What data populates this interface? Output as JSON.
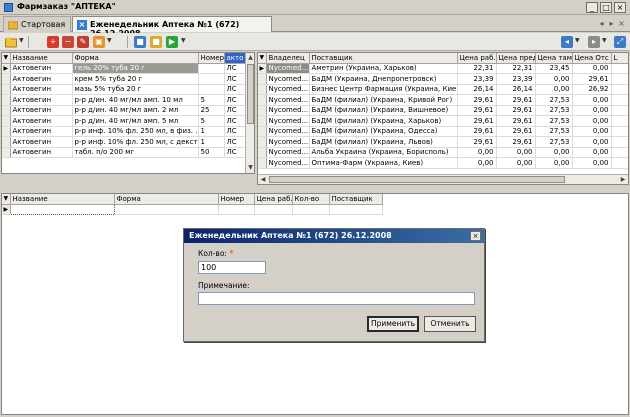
{
  "window": {
    "title": "Фармзаказ \"АПТЕКА\"",
    "min_glyph": "_",
    "max_glyph": "□",
    "close_glyph": "×"
  },
  "tabs": [
    {
      "label": "Стартовая"
    },
    {
      "label": "Еженедельник Аптека №1 (672) 26.12.2008",
      "close_glyph": "×"
    }
  ],
  "colors": {
    "accent": "#2f65c9",
    "dialog_title": "#0a246a",
    "selection": "#9a9994"
  },
  "toolbar_icons": [
    "folder-icon",
    "add-icon",
    "remove-icon",
    "edit-icon",
    "export-icon",
    "cubes-icon",
    "package-icon",
    "play-icon",
    "back-icon",
    "forward-icon",
    "expand-icon"
  ],
  "products": {
    "columns": [
      "Название",
      "Форма",
      "Номер",
      "акто"
    ],
    "rows": [
      {
        "name": "Актовегин",
        "form": "гель 20% туба 20 г",
        "number": "",
        "type": "ЛС"
      },
      {
        "name": "Актовегин",
        "form": "крем 5% туба 20 г",
        "number": "",
        "type": "ЛС"
      },
      {
        "name": "Актовегин",
        "form": "мазь 5% туба 20 г",
        "number": "",
        "type": "ЛС"
      },
      {
        "name": "Актовегин",
        "form": "р-р д/ин. 40 мг/мл амп. 10 мл",
        "number": "5",
        "type": "ЛС"
      },
      {
        "name": "Актовегин",
        "form": "р-р д/ин. 40 мг/мл амп. 2 мл",
        "number": "25",
        "type": "ЛС"
      },
      {
        "name": "Актовегин",
        "form": "р-р д/ин. 40 мг/мл амп. 5 мл",
        "number": "5",
        "type": "ЛС"
      },
      {
        "name": "Актовегин",
        "form": "р-р инф. 10% фл. 250 мл, в физ. ...",
        "number": "1",
        "type": "ЛС"
      },
      {
        "name": "Актовегин",
        "form": "р-р инф. 10% фл. 250 мл, с декстр...",
        "number": "1",
        "type": "ЛС"
      },
      {
        "name": "Актовегин",
        "form": "табл. п/о 200 мг",
        "number": "50",
        "type": "ЛС"
      }
    ]
  },
  "suppliers": {
    "columns": [
      "Владелец",
      "Поставщик",
      "Цена раб.",
      "Цена пред",
      "Цена там",
      "Цена Отс",
      "L"
    ],
    "rows": [
      {
        "owner": "Nycomed...",
        "supplier": "Аметрин (Украина, Харьков)",
        "p1": "22,31",
        "p2": "22,31",
        "p3": "23,45",
        "p4": "0,00"
      },
      {
        "owner": "Nycomed...",
        "supplier": "БаДМ (Украина, Днепропетровск)",
        "p1": "23,39",
        "p2": "23,39",
        "p3": "0,00",
        "p4": "29,61"
      },
      {
        "owner": "Nycomed...",
        "supplier": "Бизнес Центр Фармация (Украина, Киев)",
        "p1": "26,14",
        "p2": "26,14",
        "p3": "0,00",
        "p4": "26,92"
      },
      {
        "owner": "Nycomed...",
        "supplier": "БаДМ (филиал) (Украина, Кривой Рог)",
        "p1": "29,61",
        "p2": "29,61",
        "p3": "27,53",
        "p4": "0,00"
      },
      {
        "owner": "Nycomed...",
        "supplier": "БаДМ (филиал) (Украина, Вишневое)",
        "p1": "29,61",
        "p2": "29,61",
        "p3": "27,53",
        "p4": "0,00"
      },
      {
        "owner": "Nycomed...",
        "supplier": "БаДМ (филиал) (Украина, Харьков)",
        "p1": "29,61",
        "p2": "29,61",
        "p3": "27,53",
        "p4": "0,00"
      },
      {
        "owner": "Nycomed...",
        "supplier": "БаДМ (филиал) (Украина, Одесса)",
        "p1": "29,61",
        "p2": "29,61",
        "p3": "27,53",
        "p4": "0,00"
      },
      {
        "owner": "Nycomed...",
        "supplier": "БаДМ (филиал) (Украина, Львов)",
        "p1": "29,61",
        "p2": "29,61",
        "p3": "27,53",
        "p4": "0,00"
      },
      {
        "owner": "Nycomed...",
        "supplier": "Альба Украина (Украина, Борисполь)",
        "p1": "0,00",
        "p2": "0,00",
        "p3": "0,00",
        "p4": "0,00"
      },
      {
        "owner": "Nycomed...",
        "supplier": "Оптима-Фарм (Украина, Киев)",
        "p1": "0,00",
        "p2": "0,00",
        "p3": "0,00",
        "p4": "0,00"
      }
    ]
  },
  "order": {
    "columns": [
      "Название",
      "Форма",
      "Номер",
      "Цена раб.",
      "Кол-во",
      "Поставщик"
    ]
  },
  "dialog": {
    "title": "Еженедельник Аптека №1 (672) 26.12.2008",
    "close_glyph": "×",
    "qty_label": "Кол-во:",
    "required_mark": "*",
    "qty_value": "100",
    "note_label": "Примечание:",
    "note_value": "",
    "apply_label": "Применить",
    "cancel_label": "Отменить"
  }
}
